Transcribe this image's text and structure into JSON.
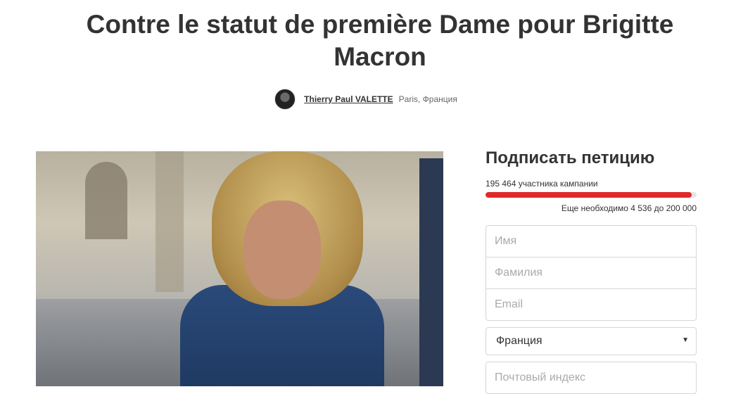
{
  "petition": {
    "title": "Contre le statut de première Dame pour Brigitte Macron",
    "author_name": "Thierry Paul VALETTE",
    "author_location": "Paris, Франция"
  },
  "sign": {
    "heading": "Подписать петицию",
    "supporters": "195 464 участника кампании",
    "progress_fraction": 0.977,
    "remaining": "Еще необходимо 4 536 до 200 000",
    "first_name_placeholder": "Имя",
    "last_name_placeholder": "Фамилия",
    "email_placeholder": "Email",
    "country_value": "Франция",
    "postal_placeholder": "Почтовый индекс"
  },
  "colors": {
    "progress": "#e0292a",
    "text": "#333333"
  }
}
